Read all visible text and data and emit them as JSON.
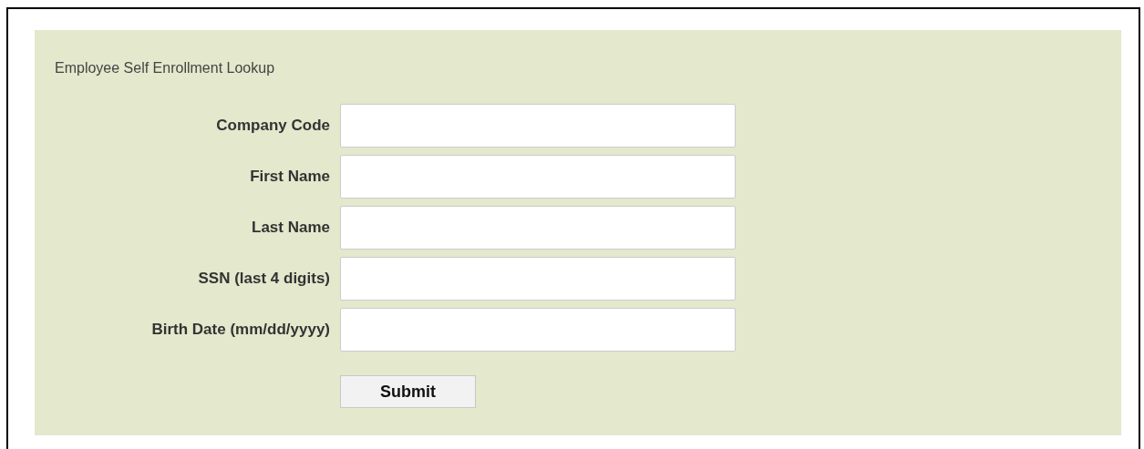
{
  "form": {
    "title": "Employee Self Enrollment Lookup",
    "fields": [
      {
        "label": "Company Code"
      },
      {
        "label": "First Name"
      },
      {
        "label": "Last Name"
      },
      {
        "label": "SSN (last 4 digits)"
      },
      {
        "label": "Birth Date (mm/dd/yyyy)"
      }
    ],
    "submit": "Submit"
  }
}
